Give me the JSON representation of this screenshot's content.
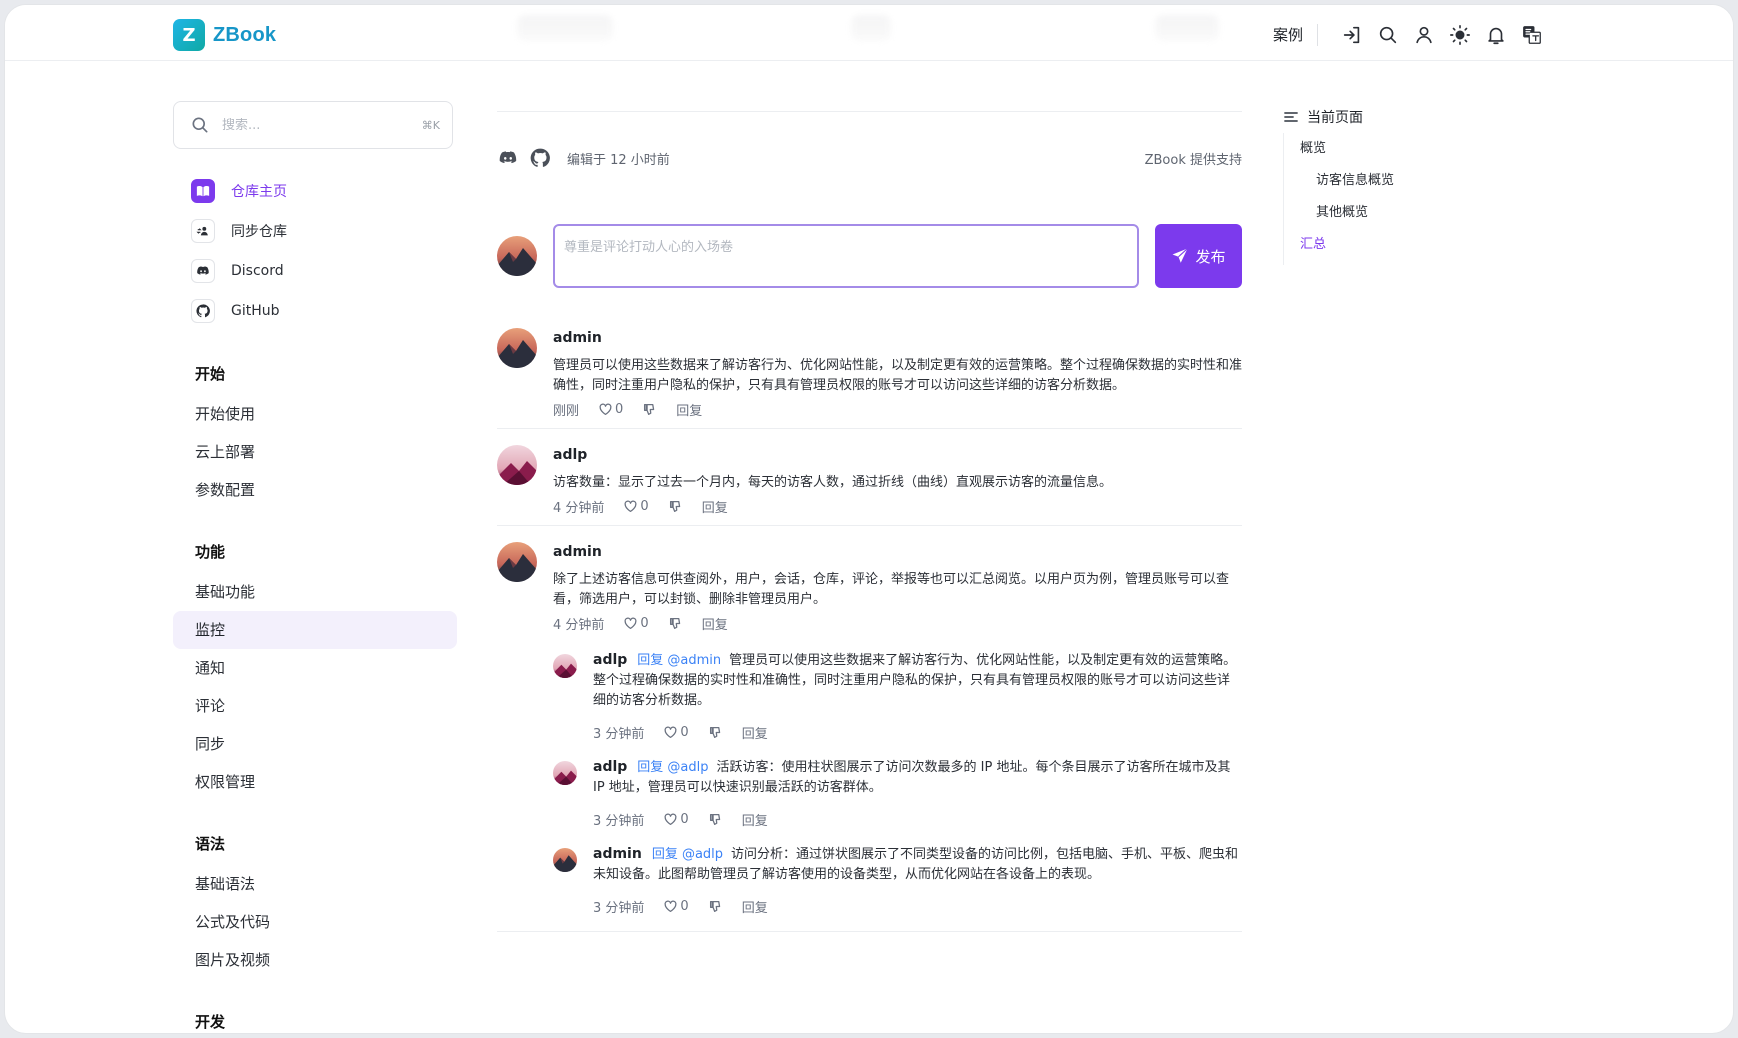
{
  "header": {
    "logo_mark": "Z",
    "logo_text": "ZBook",
    "case_link": "案例",
    "icons": [
      "sign-in-icon",
      "search-icon",
      "user-icon",
      "sun-icon",
      "bell-icon",
      "translate-icon"
    ]
  },
  "sidebar": {
    "search": {
      "placeholder": "搜索...",
      "shortcut": "⌘K"
    },
    "quick_links": [
      {
        "label": "仓库主页",
        "icon": "book-icon",
        "active": true
      },
      {
        "label": "同步仓库",
        "icon": "sync-repo-icon",
        "active": false
      },
      {
        "label": "Discord",
        "icon": "discord-icon",
        "active": false
      },
      {
        "label": "GitHub",
        "icon": "github-icon",
        "active": false
      }
    ],
    "sections": [
      {
        "title": "开始",
        "items": [
          "开始使用",
          "云上部署",
          "参数配置"
        ]
      },
      {
        "title": "功能",
        "items": [
          "基础功能",
          "监控",
          "通知",
          "评论",
          "同步",
          "权限管理"
        ]
      },
      {
        "title": "语法",
        "items": [
          "基础语法",
          "公式及代码",
          "图片及视频"
        ]
      },
      {
        "title": "开发",
        "items": []
      }
    ],
    "active_item": "监控"
  },
  "main": {
    "edited": "编辑于 12 小时前",
    "powered_by": "ZBook 提供支持",
    "composer": {
      "placeholder": "尊重是评论打动人心的入场卷",
      "publish_label": "发布"
    },
    "comments": [
      {
        "user": "admin",
        "avatar": "dark",
        "text": "管理员可以使用这些数据来了解访客行为、优化网站性能，以及制定更有效的运营策略。整个过程确保数据的实时性和准确性，同时注重用户隐私的保护，只有具有管理员权限的账号才可以访问这些详细的访客分析数据。",
        "time": "刚刚",
        "likes": "0",
        "reply_label": "回复",
        "replies": []
      },
      {
        "user": "adlp",
        "avatar": "pink",
        "text": "访客数量：显示了过去一个月内，每天的访客人数，通过折线（曲线）直观展示访客的流量信息。",
        "time": "4 分钟前",
        "likes": "0",
        "reply_label": "回复",
        "replies": []
      },
      {
        "user": "admin",
        "avatar": "dark",
        "text": "除了上述访客信息可供查阅外，用户，会话，仓库，评论，举报等也可以汇总阅览。以用户页为例，管理员账号可以查看，筛选用户，可以封锁、删除非管理员用户。",
        "time": "4 分钟前",
        "likes": "0",
        "reply_label": "回复",
        "replies": [
          {
            "user": "adlp",
            "avatar": "pink",
            "mention": "回复 @admin",
            "text": "管理员可以使用这些数据来了解访客行为、优化网站性能，以及制定更有效的运营策略。整个过程确保数据的实时性和准确性，同时注重用户隐私的保护，只有具有管理员权限的账号才可以访问这些详细的访客分析数据。",
            "time": "3 分钟前",
            "likes": "0",
            "reply_label": "回复"
          },
          {
            "user": "adlp",
            "avatar": "pink",
            "mention": "回复 @adlp",
            "text": "活跃访客：使用柱状图展示了访问次数最多的 IP 地址。每个条目展示了访客所在城市及其 IP 地址，管理员可以快速识别最活跃的访客群体。",
            "time": "3 分钟前",
            "likes": "0",
            "reply_label": "回复"
          },
          {
            "user": "admin",
            "avatar": "dark",
            "mention": "回复 @adlp",
            "text": "访问分析：通过饼状图展示了不同类型设备的访问比例，包括电脑、手机、平板、爬虫和未知设备。此图帮助管理员了解访客使用的设备类型，从而优化网站在各设备上的表现。",
            "time": "3 分钟前",
            "likes": "0",
            "reply_label": "回复"
          }
        ]
      }
    ]
  },
  "toc": {
    "title": "当前页面",
    "items": [
      {
        "label": "概览",
        "level": 1,
        "active": false
      },
      {
        "label": "访客信息概览",
        "level": 2,
        "active": false
      },
      {
        "label": "其他概览",
        "level": 2,
        "active": false
      },
      {
        "label": "汇总",
        "level": 1,
        "active": true
      }
    ]
  },
  "colors": {
    "accent": "#7c3aed",
    "accent_light": "#f3f0fc",
    "mention": "#3b82f6",
    "logo": "#1796c8"
  }
}
